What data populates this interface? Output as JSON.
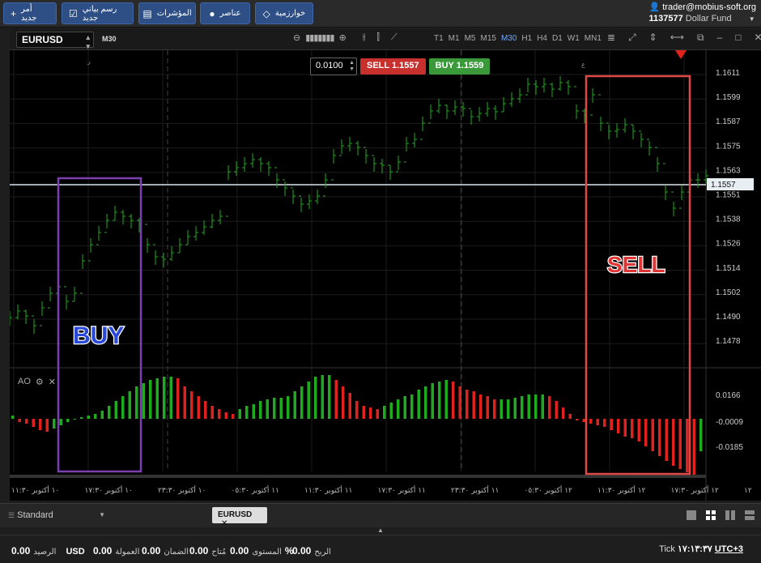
{
  "topbar": {
    "new_order": "أمر جديد",
    "new_chart": "رسم بياني جديد",
    "indicators": "المؤشرات",
    "elements": "عناصر",
    "algorithms": "خوارزمية",
    "account_email": "trader@mobius-soft.org",
    "account_number": "1137577",
    "account_name": "Dollar Fund"
  },
  "toolbar": {
    "symbol": "EURUSD",
    "timeframe_current": "M30",
    "timeframes": [
      "T1",
      "M1",
      "M5",
      "M15",
      "M30",
      "H1",
      "H4",
      "D1",
      "W1",
      "MN1"
    ],
    "active_timeframe": "M30"
  },
  "order": {
    "lot": "0.0100",
    "sell_label": "SELL 1.1557",
    "buy_label": "BUY 1.1559"
  },
  "chart": {
    "price_labels": [
      "1.1611",
      "1.1599",
      "1.1587",
      "1.1575",
      "1.1563",
      "1.1551",
      "1.1538",
      "1.1526",
      "1.1514",
      "1.1502",
      "1.1490",
      "1.1478"
    ],
    "current_price": "1.1557",
    "ao_labels": [
      "0.0166",
      "-0.0009",
      "-0.0185"
    ],
    "ao_title": "AO",
    "buy_annotation": "BUY",
    "sell_annotation": "SELL",
    "time_labels": [
      "١٠ أكتوبر ١١:٣٠",
      "١٠ أكتوبر ١٧:٣٠",
      "١٠ أكتوبر ٢٣:٣٠",
      "١١ أكتوبر ٠٥:٣٠",
      "١١ أكتوبر ١١:٣٠",
      "١١ أكتوبر ١٧:٣٠",
      "١١ أكتوبر ٢٣:٣٠",
      "١٢ أكتوبر ٠٥:٣٠",
      "١٢ أكتوبر ١١:٣٠",
      "١٢ أكتوبر ١٧:٣٠",
      "١٢"
    ],
    "small_glyph": "ر",
    "small_glyph2": "ع",
    "colors": {
      "up": "#1faa1f",
      "down": "#e0221f",
      "buy_box": "#7b3fb0",
      "sell_box": "#e04848"
    }
  },
  "statusbar": {
    "account_type": "Standard",
    "tab_symbol": "EURUSD"
  },
  "bottom": {
    "balance_value": "0.00",
    "balance_label": "الرصيد",
    "currency": "USD",
    "credit_value": "0.00",
    "credit_label": "العمولة",
    "margin_value": "0.00",
    "margin_label": "الضمان",
    "free_value": "0.00",
    "free_label": "مُتاح",
    "level_value": "%",
    "level_label": "المستوى",
    "profit_value": "0.00",
    "profit_label": "الربح",
    "tick_label": "Tick",
    "tick_time": "١٧:١٣:٣٧",
    "utc": "UTC+3"
  }
}
